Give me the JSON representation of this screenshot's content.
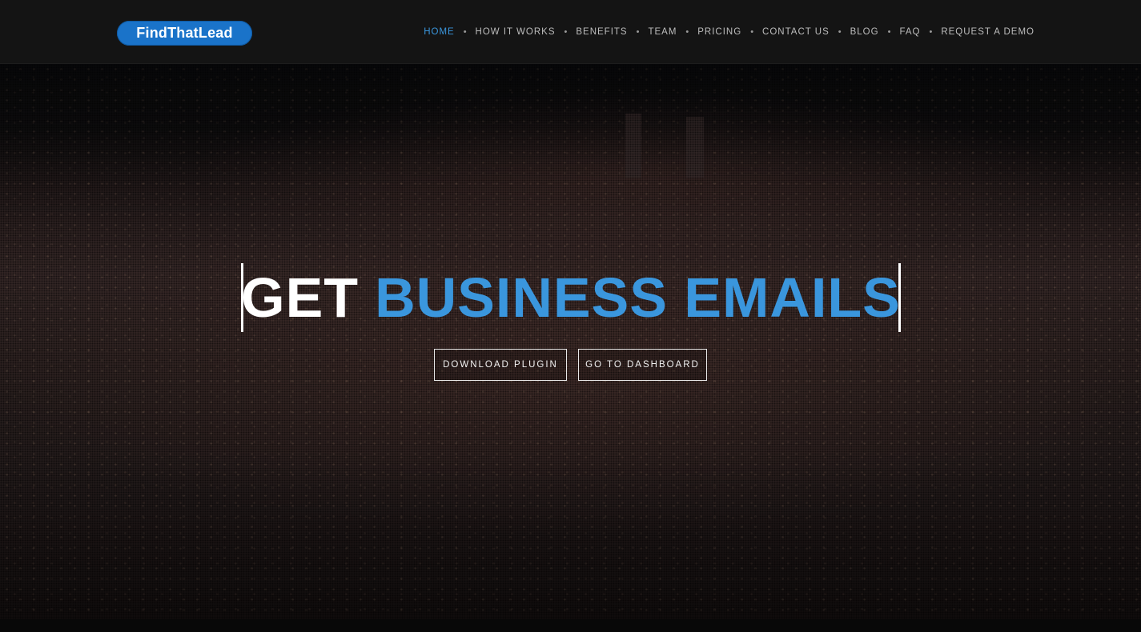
{
  "brand": {
    "logo_text": "FindThatLead",
    "logo_color": "#1a73c9"
  },
  "nav": {
    "items": [
      {
        "label": "HOME",
        "active": true
      },
      {
        "label": "HOW IT WORKS",
        "active": false
      },
      {
        "label": "BENEFITS",
        "active": false
      },
      {
        "label": "TEAM",
        "active": false
      },
      {
        "label": "PRICING",
        "active": false
      },
      {
        "label": "CONTACT US",
        "active": false
      },
      {
        "label": "BLOG",
        "active": false
      },
      {
        "label": "FAQ",
        "active": false
      },
      {
        "label": "REQUEST A DEMO",
        "active": false
      }
    ],
    "separator": "•"
  },
  "hero": {
    "headline_prefix": "GET",
    "headline_highlight": "BUSINESS EMAILS",
    "buttons": {
      "download": "DOWNLOAD PLUGIN",
      "dashboard": "GO TO DASHBOARD"
    },
    "background": "night-city-skyline-image"
  },
  "colors": {
    "accent": "#3a96dd",
    "header_bg": "#141414",
    "nav_text": "#bdbdbd"
  }
}
